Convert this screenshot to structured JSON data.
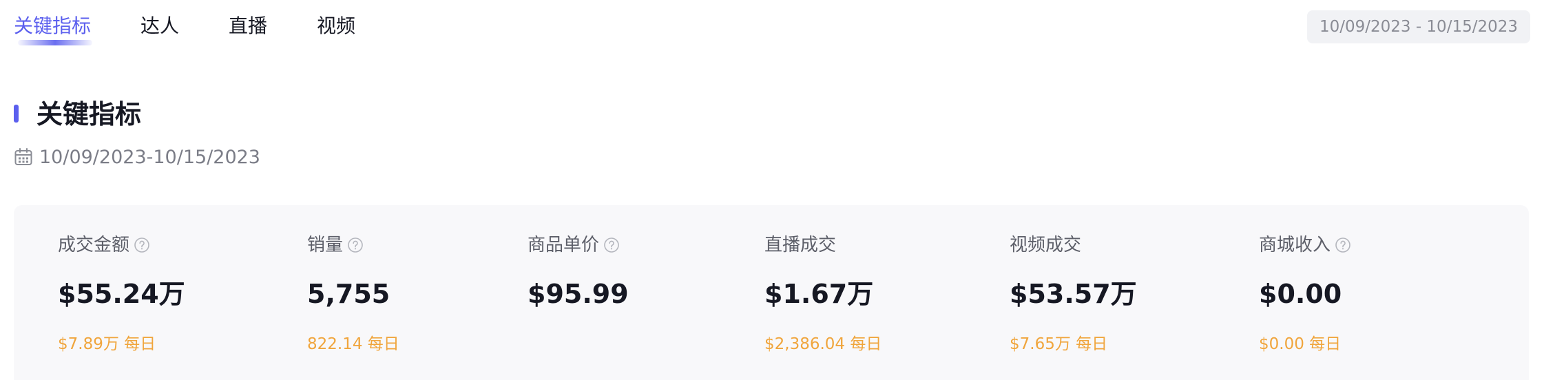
{
  "tabs": [
    {
      "label": "关键指标",
      "active": true
    },
    {
      "label": "达人",
      "active": false
    },
    {
      "label": "直播",
      "active": false
    },
    {
      "label": "视频",
      "active": false
    }
  ],
  "date_range_picker": {
    "value": "10/09/2023 - 10/15/2023"
  },
  "section": {
    "title": "关键指标",
    "date_range": "10/09/2023-10/15/2023"
  },
  "metrics": [
    {
      "label": "成交金额",
      "has_help": true,
      "value": "$55.24万",
      "daily": "$7.89万 每日"
    },
    {
      "label": "销量",
      "has_help": true,
      "value": "5,755",
      "daily": "822.14 每日"
    },
    {
      "label": "商品单价",
      "has_help": true,
      "value": "$95.99",
      "daily": ""
    },
    {
      "label": "直播成交",
      "has_help": false,
      "value": "$1.67万",
      "daily": "$2,386.04 每日"
    },
    {
      "label": "视频成交",
      "has_help": false,
      "value": "$53.57万",
      "daily": "$7.65万 每日"
    },
    {
      "label": "商城收入",
      "has_help": true,
      "value": "$0.00",
      "daily": "$0.00 每日"
    }
  ],
  "colors": {
    "accent": "#5b5fee",
    "daily_text": "#f0a53c",
    "card_bg": "#f8f8fa",
    "pill_bg": "#f1f2f5"
  }
}
